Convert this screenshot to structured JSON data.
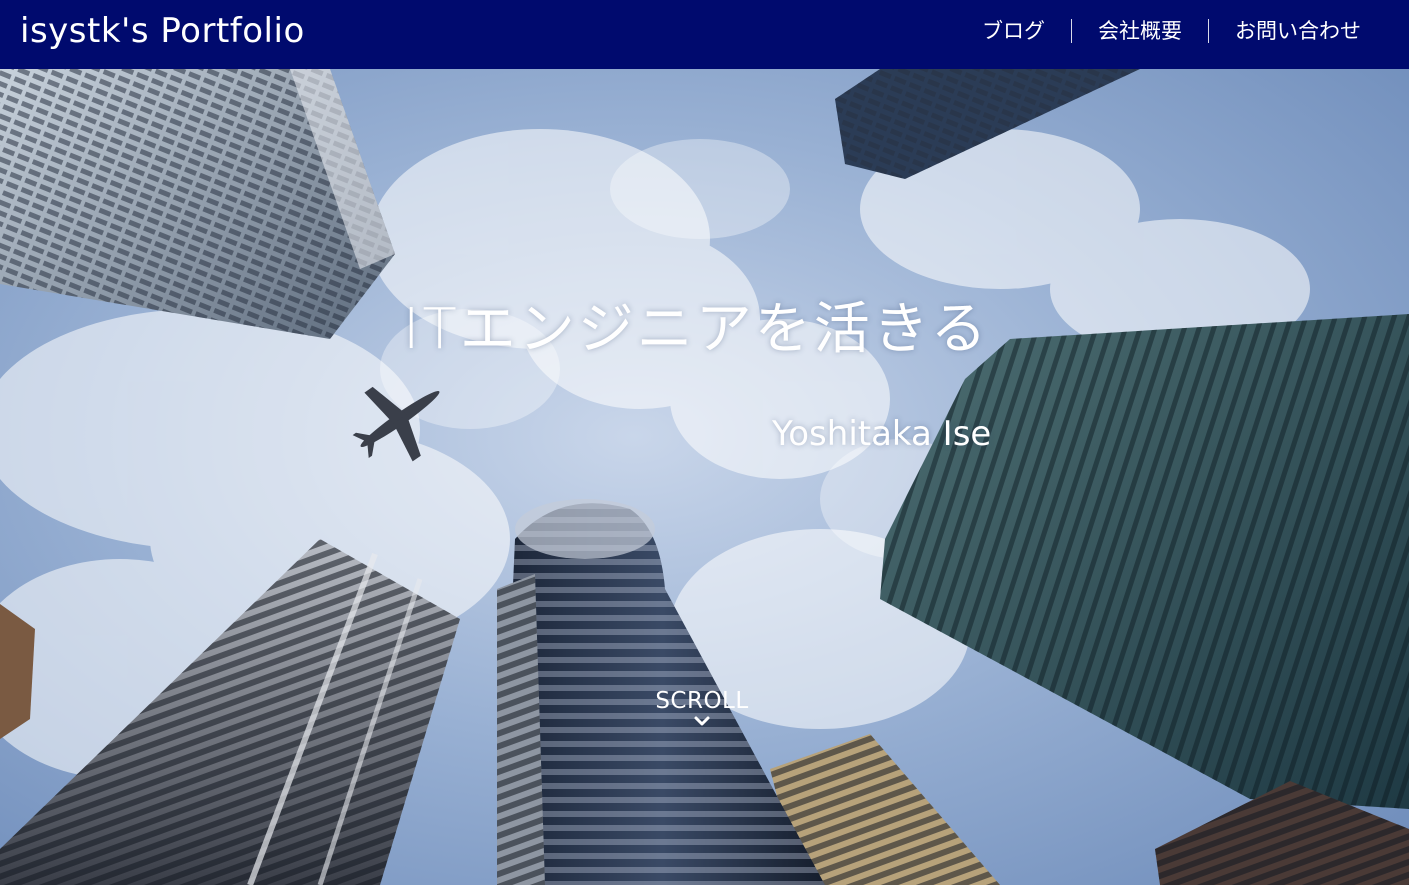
{
  "header": {
    "brand": "isystk's Portfolio",
    "nav": [
      {
        "label": "ブログ"
      },
      {
        "label": "会社概要"
      },
      {
        "label": "お問い合わせ"
      }
    ],
    "background_color": "#000a6e"
  },
  "hero": {
    "title": "ITエンジニアを活きる",
    "subtitle": "Yoshitaka Ise",
    "scroll_label": "SCROLL",
    "scroll_icon": "chevron-down-icon"
  }
}
